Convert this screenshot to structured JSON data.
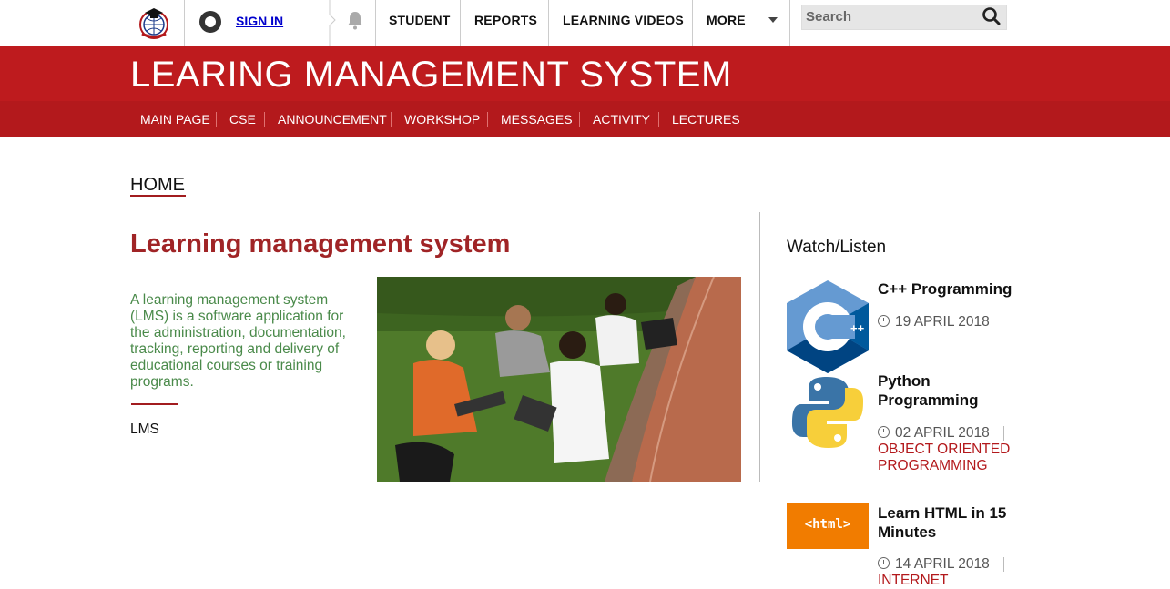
{
  "topbar": {
    "signin_label": "SIGN IN",
    "nav": [
      "STUDENT",
      "REPORTS",
      "LEARNING VIDEOS",
      "MORE"
    ],
    "search_placeholder": "Search"
  },
  "banner": {
    "title": "LEARING MANAGEMENT SYSTEM",
    "subnav": [
      "MAIN PAGE",
      "CSE",
      "ANNOUNCEMENT",
      "WORKSHOP",
      "MESSAGES",
      "ACTIVITY",
      "LECTURES"
    ]
  },
  "main": {
    "breadcrumb": "HOME",
    "title": "Learning management system",
    "intro": "A learning management system (LMS) is a software application for the administration, documentation, tracking, reporting and delivery of educational courses or training programs.",
    "tag": "LMS"
  },
  "sidebar": {
    "heading": "Watch/Listen",
    "videos": [
      {
        "title": "C++ Programming",
        "date": "19 APRIL 2018",
        "category": ""
      },
      {
        "title": "Python Programming",
        "date": "02 APRIL 2018",
        "category": "OBJECT ORIENTED PROGRAMMING"
      },
      {
        "title": "Learn HTML in 15 Minutes",
        "date": "14 APRIL 2018",
        "category": "INTERNET"
      }
    ],
    "html_thumb_text": "<html>"
  },
  "colors": {
    "brand_red": "#b3191c",
    "title_red": "#a02426",
    "intro_green": "#4a8a4a",
    "html_orange": "#f17c00"
  }
}
